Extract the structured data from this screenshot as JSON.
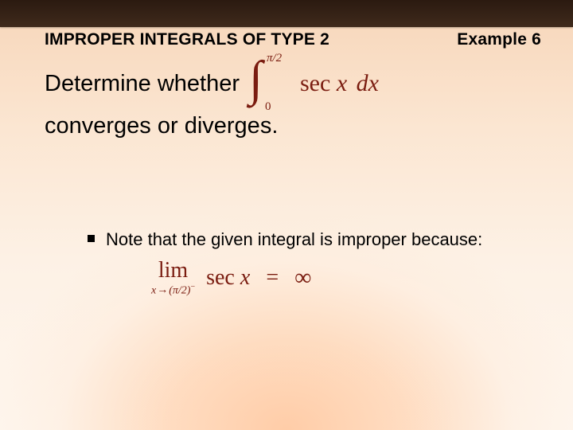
{
  "header": {
    "title": "IMPROPER INTEGRALS OF TYPE 2",
    "example": "Example 6"
  },
  "main": {
    "line1_pre": "Determine whether",
    "line2": "converges or diverges.",
    "integral": {
      "upper_pi": "π",
      "upper_slash2": "/2",
      "lower": "0",
      "sec_text": "sec",
      "x_text": "x",
      "dx_text": "dx"
    }
  },
  "note": {
    "text": "Note that the given integral is improper because:",
    "limit": {
      "lim_word": "lim",
      "sub_x": "x",
      "arrow": "→",
      "sub_pi": "π",
      "sub_slash2": "/2",
      "minus": "−",
      "sec_text": "sec",
      "x_text": "x",
      "eq": "=",
      "inf": "∞"
    }
  }
}
